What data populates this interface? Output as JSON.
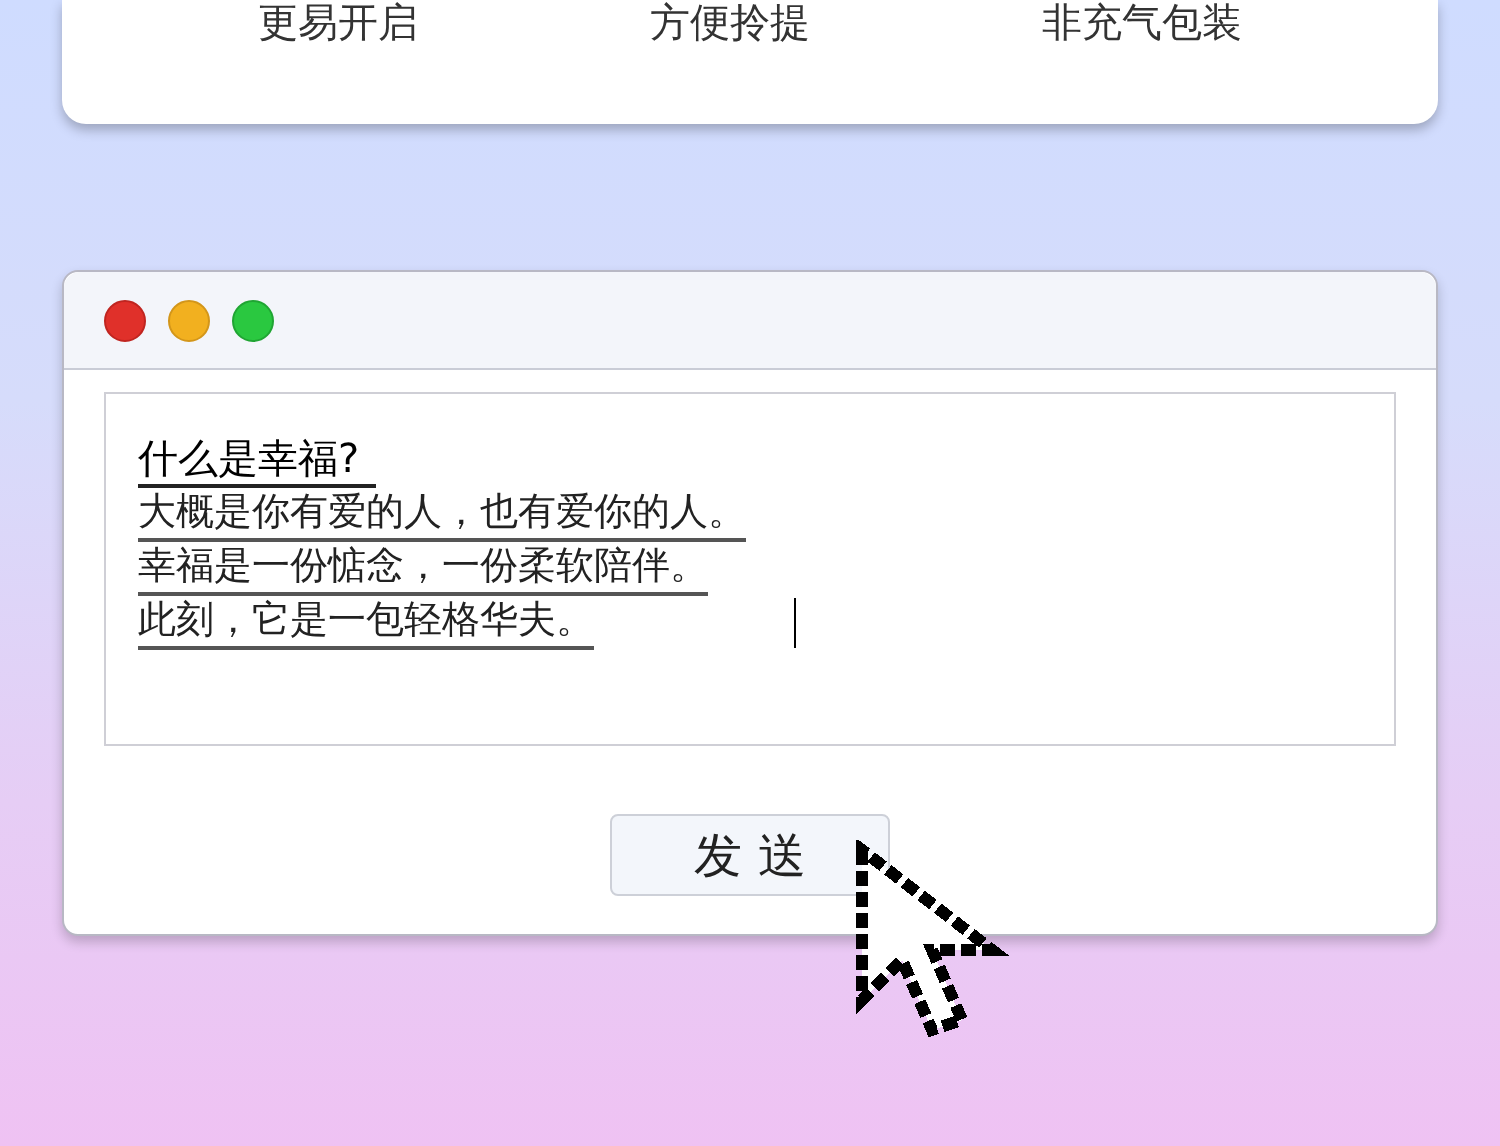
{
  "top_card": {
    "features": [
      "更易开启",
      "方便拎提",
      "非充气包装"
    ]
  },
  "window": {
    "editor": {
      "title": "什么是幸福?",
      "lines": [
        "大概是你有爱的人，也有爱你的人。",
        "幸福是一份惦念，一份柔软陪伴。",
        "此刻，它是一包轻格华夫。"
      ]
    },
    "send_button": "发 送"
  }
}
